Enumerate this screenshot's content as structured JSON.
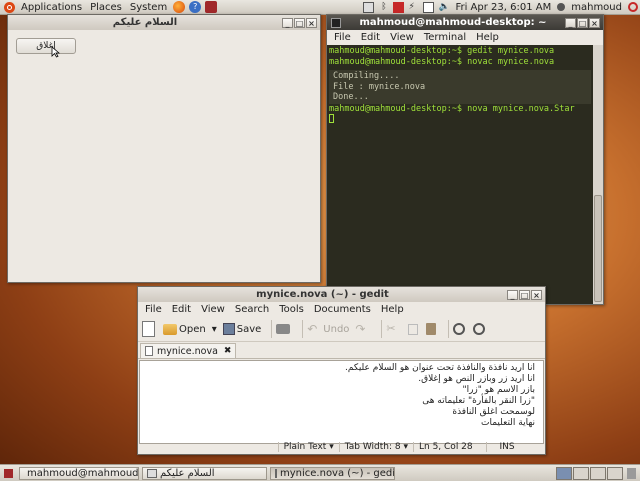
{
  "top_panel": {
    "menus": [
      "Applications",
      "Places",
      "System"
    ],
    "clock": "Fri Apr 23,  6:01 AM",
    "user": "mahmoud"
  },
  "arabic_window": {
    "title": "السلام عليكم",
    "button_label": "إغلاق"
  },
  "terminal_window": {
    "title": "mahmoud@mahmoud-desktop: ~",
    "menus": [
      "File",
      "Edit",
      "View",
      "Terminal",
      "Help"
    ],
    "lines": [
      "mahmoud@mahmoud-desktop:~$ gedit mynice.nova",
      "mahmoud@mahmoud-desktop:~$ novac mynice.nova"
    ],
    "output": [
      "Compiling....",
      "File : mynice.nova",
      "Done..."
    ],
    "last_line": "mahmoud@mahmoud-desktop:~$ nova mynice.nova.Star"
  },
  "gedit_window": {
    "title": "mynice.nova (~) - gedit",
    "menus": [
      "File",
      "Edit",
      "View",
      "Search",
      "Tools",
      "Documents",
      "Help"
    ],
    "toolbar": {
      "open": "Open",
      "save": "Save",
      "undo": "Undo"
    },
    "tab": "mynice.nova",
    "tab_close": "✖",
    "content": [
      "انا اريد نافذة والنافذة تحت عنوان هو السلام عليكم.",
      "انا اريد زر وبازر النص هو إغلاق.",
      "بازر الاسم هو \"زرا\"",
      "\"زرا النقر بالفأرة\" تعليماته هى",
      "لوسمحت اغلق النافذة",
      "نهاية التعليمات"
    ],
    "status": {
      "syntax": "Plain Text",
      "tab_width": "Tab Width:  8",
      "position": "Ln 5, Col 28",
      "mode": "INS"
    }
  },
  "taskbar": {
    "tasks": [
      "mahmoud@mahmoud...",
      "السلام عليكم",
      "mynice.nova (~) - gedit"
    ]
  },
  "colors": {
    "terminal_bg": "#2b2b1f",
    "terminal_fg": "#9fe03a",
    "titlebar_active": "#3c3a36"
  }
}
